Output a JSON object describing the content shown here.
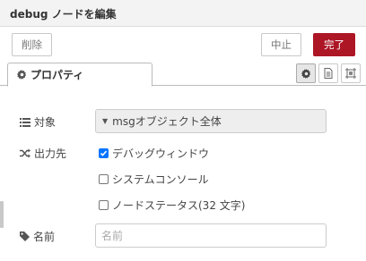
{
  "header": {
    "title": "debug ノードを編集"
  },
  "buttons": {
    "delete": "削除",
    "cancel": "中止",
    "done": "完了"
  },
  "tabs": {
    "properties": {
      "label": "プロパティ",
      "icon": "cog-icon"
    },
    "icon_buttons": [
      "settings-icon",
      "description-icon",
      "appearance-icon"
    ]
  },
  "form": {
    "target": {
      "label": "対象",
      "icon": "list-icon",
      "value": "msgオブジェクト全体"
    },
    "output": {
      "label": "出力先",
      "icon": "random-icon",
      "options": [
        {
          "label": "デバッグウィンドウ",
          "checked": true
        },
        {
          "label": "システムコンソール",
          "checked": false
        },
        {
          "label": "ノードステータス(32 文字)",
          "checked": false
        }
      ]
    },
    "name": {
      "label": "名前",
      "icon": "tag-icon",
      "placeholder": "名前",
      "value": ""
    }
  },
  "colors": {
    "primary": "#ad1625",
    "checkbox": "#0075ff"
  }
}
